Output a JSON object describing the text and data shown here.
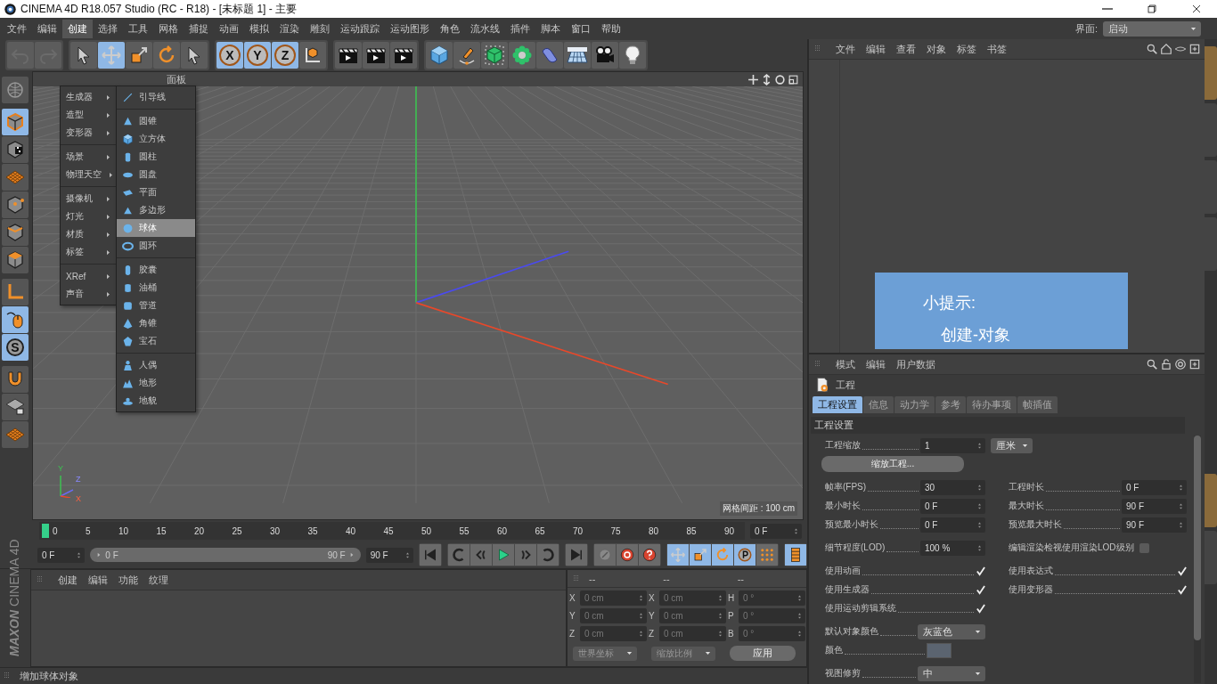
{
  "window": {
    "title": "CINEMA 4D R18.057 Studio (RC - R18) - [未标题 1] - 主要"
  },
  "menu_bar": [
    {
      "label": "文件",
      "selected": false
    },
    {
      "label": "编辑",
      "selected": false
    },
    {
      "label": "创建",
      "selected": true
    },
    {
      "label": "选择",
      "selected": false
    },
    {
      "label": "工具",
      "selected": false
    },
    {
      "label": "网格",
      "selected": false
    },
    {
      "label": "捕捉",
      "selected": false
    },
    {
      "label": "动画",
      "selected": false
    },
    {
      "label": "模拟",
      "selected": false
    },
    {
      "label": "渲染",
      "selected": false
    },
    {
      "label": "雕刻",
      "selected": false
    },
    {
      "label": "运动跟踪",
      "selected": false
    },
    {
      "label": "运动图形",
      "selected": false
    },
    {
      "label": "角色",
      "selected": false
    },
    {
      "label": "流水线",
      "selected": false
    },
    {
      "label": "插件",
      "selected": false
    },
    {
      "label": "脚本",
      "selected": false
    },
    {
      "label": "窗口",
      "selected": false
    },
    {
      "label": "帮助",
      "selected": false
    }
  ],
  "layout_selector": {
    "label": "界面:",
    "value": "启动"
  },
  "toolbar": {
    "axis_buttons": [
      {
        "label": "X",
        "on": true
      },
      {
        "label": "Y",
        "on": true
      },
      {
        "label": "Z",
        "on": true
      }
    ]
  },
  "left_tools": [
    {
      "on": false
    },
    {
      "on": true
    },
    {
      "on": false
    },
    {
      "on": false
    },
    {
      "on": false
    },
    {
      "on": false
    },
    {
      "on": false
    },
    {
      "on": false
    },
    {
      "on": true
    },
    {
      "on": true,
      "label": "S"
    },
    {
      "on": false
    },
    {
      "on": false
    },
    {
      "on": false
    }
  ],
  "create_menu": {
    "groups": [
      {
        "items": [
          "生成器",
          "造型",
          "变形器"
        ]
      },
      {
        "items": [
          "场景",
          "物理天空"
        ]
      },
      {
        "items": [
          "摄像机",
          "灯光",
          "材质",
          "标签"
        ]
      },
      {
        "items": [
          "XRef",
          "声音"
        ]
      }
    ],
    "submenu": [
      {
        "items": [
          {
            "label": "引导线",
            "selected": false
          }
        ]
      },
      {
        "items": [
          {
            "label": "圆锥",
            "selected": false
          },
          {
            "label": "立方体",
            "selected": false
          },
          {
            "label": "圆柱",
            "selected": false
          },
          {
            "label": "圆盘",
            "selected": false
          },
          {
            "label": "平面",
            "selected": false
          },
          {
            "label": "多边形",
            "selected": false
          },
          {
            "label": "球体",
            "selected": true
          },
          {
            "label": "圆环",
            "selected": false
          }
        ]
      },
      {
        "items": [
          {
            "label": "胶囊",
            "selected": false
          },
          {
            "label": "油桶",
            "selected": false
          },
          {
            "label": "管道",
            "selected": false
          },
          {
            "label": "角锥",
            "selected": false
          },
          {
            "label": "宝石",
            "selected": false
          }
        ]
      },
      {
        "items": [
          {
            "label": "人偶",
            "selected": false
          },
          {
            "label": "地形",
            "selected": false
          },
          {
            "label": "地貌",
            "selected": false
          }
        ]
      }
    ]
  },
  "viewport": {
    "menu": [
      "面板"
    ],
    "grid_spacing": "网格间距 : 100 cm",
    "gizmo_axes": [
      "Y",
      "Z",
      "X"
    ]
  },
  "timeline": {
    "ticks": [
      "0",
      "5",
      "10",
      "15",
      "20",
      "25",
      "30",
      "35",
      "40",
      "45",
      "50",
      "55",
      "60",
      "65",
      "70",
      "75",
      "80",
      "85",
      "90"
    ],
    "current_frame": "0 F",
    "start": "0 F",
    "range": {
      "start": "0 F",
      "end": "90 F",
      "level": 1
    },
    "end": "90 F"
  },
  "material_manager": {
    "menu": [
      "创建",
      "编辑",
      "功能",
      "纹理"
    ]
  },
  "logo": {
    "brand": "MAXON",
    "product": "CINEMA 4D"
  },
  "coordinates": {
    "headers": [
      "--",
      "--",
      "--"
    ],
    "rows": [
      {
        "pos_axis": "X",
        "position": "0 cm",
        "size_axis": "X",
        "size": "0 cm",
        "rot_axis": "H",
        "rotation": "0 °"
      },
      {
        "pos_axis": "Y",
        "position": "0 cm",
        "size_axis": "Y",
        "size": "0 cm",
        "rot_axis": "P",
        "rotation": "0 °"
      },
      {
        "pos_axis": "Z",
        "position": "0 cm",
        "size_axis": "Z",
        "size": "0 cm",
        "rot_axis": "B",
        "rotation": "0 °"
      }
    ],
    "mode": "世界坐标",
    "scale_mode": "缩放比例",
    "apply": "应用"
  },
  "status_bar": "增加球体对象",
  "object_manager": {
    "menu": [
      "文件",
      "编辑",
      "查看",
      "对象",
      "标签",
      "书签"
    ]
  },
  "attributes": {
    "menu": [
      "模式",
      "编辑",
      "用户数据"
    ],
    "title": "工程",
    "tabs": [
      {
        "label": "工程设置",
        "selected": true
      },
      {
        "label": "信息",
        "selected": false
      },
      {
        "label": "动力学",
        "selected": false
      },
      {
        "label": "参考",
        "selected": false
      },
      {
        "label": "待办事项",
        "selected": false
      },
      {
        "label": "帧插值",
        "selected": false
      }
    ],
    "section": "工程设置",
    "scale": {
      "label": "工程缩放",
      "value": "1",
      "unit": "厘米"
    },
    "scale_button": "缩放工程...",
    "time_rows": [
      {
        "label": "帧率(FPS)",
        "value": "30",
        "label2": "工程时长",
        "value2": "0 F"
      },
      {
        "label": "最小时长",
        "value": "0 F",
        "label2": "最大时长",
        "value2": "90 F"
      },
      {
        "label": "预览最小时长",
        "value": "0 F",
        "label2": "预览最大时长",
        "value2": "90 F"
      }
    ],
    "lod": {
      "label": "细节程度(LOD)",
      "value": "100 %",
      "check_label": "编辑渲染检视使用渲染LOD级别",
      "checked": false
    },
    "checks": [
      {
        "label": "使用动画",
        "checked": true
      },
      {
        "label": "使用表达式",
        "checked": true
      },
      {
        "label": "使用生成器",
        "checked": true
      },
      {
        "label": "使用变形器",
        "checked": true
      },
      {
        "label": "使用运动剪辑系统",
        "checked": true
      }
    ],
    "default_color": {
      "label": "默认对象颜色",
      "value": "灰蓝色"
    },
    "color": {
      "label": "颜色",
      "color": "#5b6470"
    },
    "view_clip": {
      "label": "视图修剪",
      "value": "中"
    }
  },
  "tip": {
    "title": "小提示:",
    "text": "创建-对象"
  }
}
